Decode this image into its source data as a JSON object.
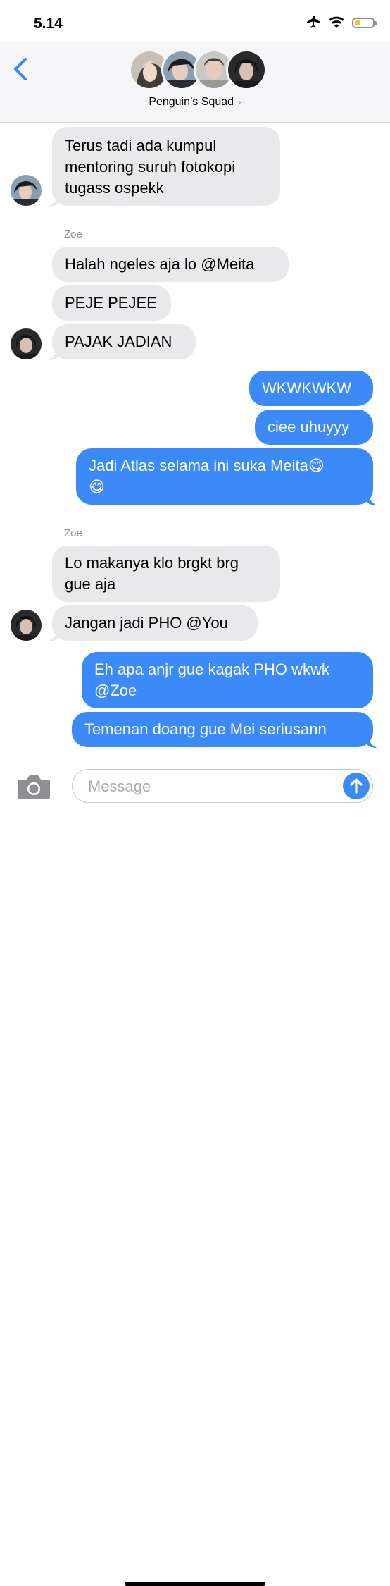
{
  "status_bar": {
    "time": "5.14",
    "battery_level": 0.35
  },
  "header": {
    "back_icon": "chevron-left-icon",
    "group_name": "Penguin’s Squad",
    "chevron": "›"
  },
  "colors": {
    "sent_bubble": "#3b8af7",
    "received_bubble": "#e9e9eb",
    "accent": "#3b8af7"
  },
  "messages": [
    {
      "sender": "",
      "direction": "received",
      "text": "Terus tadi ada kumpul\nmentoring suruh fotokopi\ntugass ospekk"
    },
    {
      "sender": "Zoe",
      "direction": "received",
      "text": "Halah ngeles aja lo @Meita"
    },
    {
      "sender": "Zoe",
      "direction": "received",
      "text": "PEJE PEJEE"
    },
    {
      "sender": "Zoe",
      "direction": "received",
      "text": "PAJAK JADIAN"
    },
    {
      "sender": "me",
      "direction": "sent",
      "text": "WKWKWKW"
    },
    {
      "sender": "me",
      "direction": "sent",
      "text": "ciee uhuyyy"
    },
    {
      "sender": "me",
      "direction": "sent",
      "text": "Jadi Atlas selama ini suka Meita😋\n😋"
    },
    {
      "sender": "Zoe",
      "direction": "received",
      "text": "Lo makanya klo brgkt brg\ngue aja"
    },
    {
      "sender": "Zoe",
      "direction": "received",
      "text": "Jangan jadi PHO @You"
    },
    {
      "sender": "me",
      "direction": "sent",
      "text": "Eh apa anjr gue kagak PHO wkwk\n@Zoe"
    },
    {
      "sender": "me",
      "direction": "sent",
      "text": "Temenan doang gue Mei seriusann"
    }
  ],
  "labels": {
    "zoe_1": "Zoe",
    "zoe_2": "Zoe"
  },
  "input": {
    "placeholder": "Message",
    "value": "",
    "camera_icon": "camera-icon",
    "send_icon": "arrow-up-icon"
  }
}
